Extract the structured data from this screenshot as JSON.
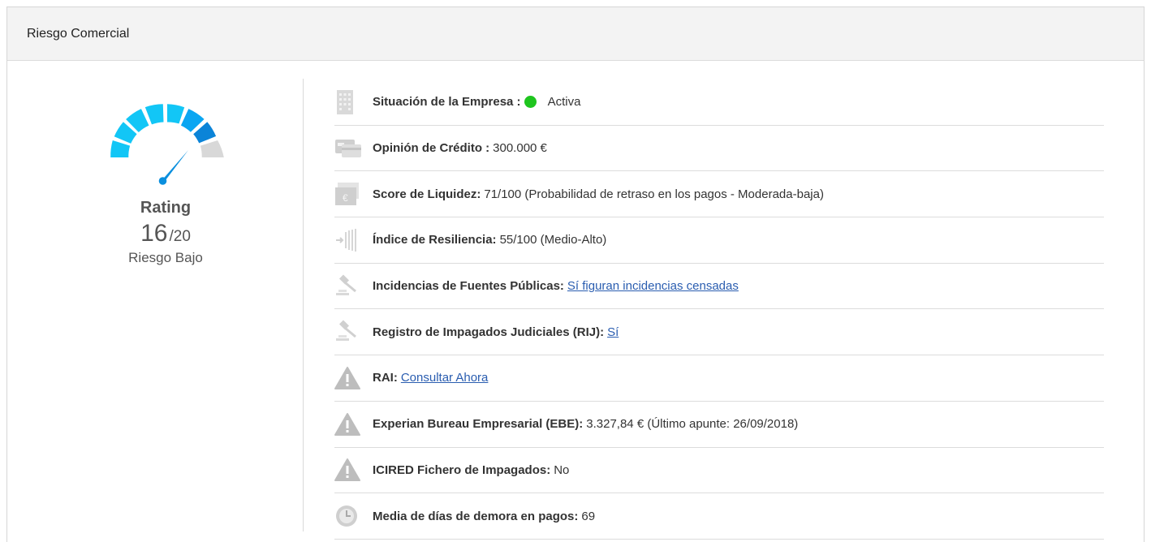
{
  "panel": {
    "title": "Riesgo Comercial"
  },
  "rating": {
    "title": "Rating",
    "score": "16",
    "max": "/20",
    "level": "Riesgo Bajo",
    "value_fraction": 0.8
  },
  "colors": {
    "status_active": "#1fc51f",
    "gauge_light": "#12c6f6",
    "gauge_mid": "#0aa6f2",
    "gauge_dark": "#0b84d8",
    "gauge_empty": "#d8d8d8",
    "link": "#2a5db0"
  },
  "items": [
    {
      "icon": "building-icon",
      "label": "Situación de la Empresa :",
      "value": "Activa"
    },
    {
      "icon": "credit-card-icon",
      "label": "Opinión de Crédito :",
      "value": "300.000 €"
    },
    {
      "icon": "euro-note-icon",
      "label": "Score de Liquidez:",
      "value": "71/100 (Probabilidad de retraso en los pagos - Moderada-baja)"
    },
    {
      "icon": "resilience-arrow-icon",
      "label": "Índice de Resiliencia:",
      "value": "55/100 (Medio-Alto)"
    },
    {
      "icon": "gavel-icon",
      "label": "Incidencias de Fuentes Públicas:",
      "link": "Sí figuran incidencias censadas"
    },
    {
      "icon": "gavel-icon",
      "label": "Registro de Impagados Judiciales (RIJ):",
      "link": "Sí"
    },
    {
      "icon": "warning-icon",
      "label": "RAI:",
      "link": "Consultar Ahora"
    },
    {
      "icon": "warning-icon",
      "label": "Experian Bureau Empresarial (EBE):",
      "value": "3.327,84 € (Último apunte: 26/09/2018)"
    },
    {
      "icon": "warning-icon",
      "label": "ICIRED Fichero de Impagados:",
      "value": "No"
    },
    {
      "icon": "clock-icon",
      "label": "Media de días de demora en pagos:",
      "value": "69"
    }
  ]
}
